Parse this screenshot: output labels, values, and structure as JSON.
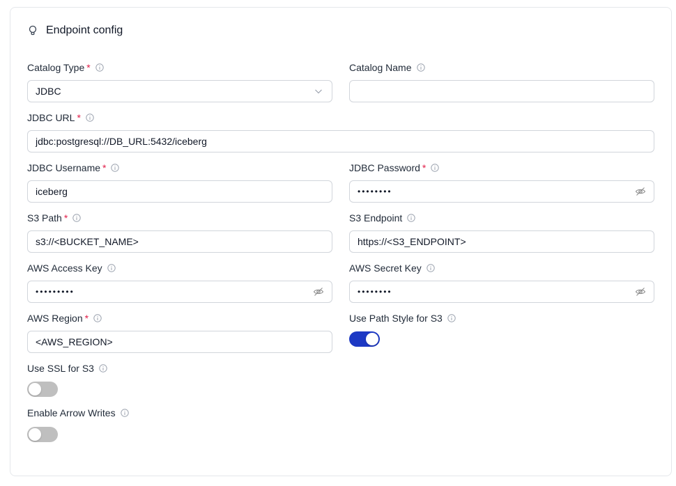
{
  "header": {
    "title": "Endpoint config",
    "icon": "lightbulb-icon"
  },
  "fields": {
    "catalog_type": {
      "label": "Catalog Type",
      "required": "*",
      "value": "JDBC"
    },
    "catalog_name": {
      "label": "Catalog Name",
      "value": ""
    },
    "jdbc_url": {
      "label": "JDBC URL",
      "required": "*",
      "value": "jdbc:postgresql://DB_URL:5432/iceberg"
    },
    "jdbc_username": {
      "label": "JDBC Username",
      "required": "*",
      "value": "iceberg"
    },
    "jdbc_password": {
      "label": "JDBC Password",
      "required": "*",
      "value": "••••••••"
    },
    "s3_path": {
      "label": "S3 Path",
      "required": "*",
      "value": "s3://<BUCKET_NAME>"
    },
    "s3_endpoint": {
      "label": "S3 Endpoint",
      "value": "https://<S3_ENDPOINT>"
    },
    "aws_access_key": {
      "label": "AWS Access Key",
      "value": "•••••••••"
    },
    "aws_secret_key": {
      "label": "AWS Secret Key",
      "value": "••••••••"
    },
    "aws_region": {
      "label": "AWS Region",
      "required": "*",
      "value": "<AWS_REGION>"
    }
  },
  "toggles": {
    "use_path_style": {
      "label": "Use Path Style for S3",
      "on": true
    },
    "use_ssl": {
      "label": "Use SSL for S3",
      "on": false
    },
    "arrow_writes": {
      "label": "Enable Arrow Writes",
      "on": false
    }
  },
  "colors": {
    "accent": "#1d39c4",
    "required": "#e11d48",
    "border": "#d1d5db"
  }
}
